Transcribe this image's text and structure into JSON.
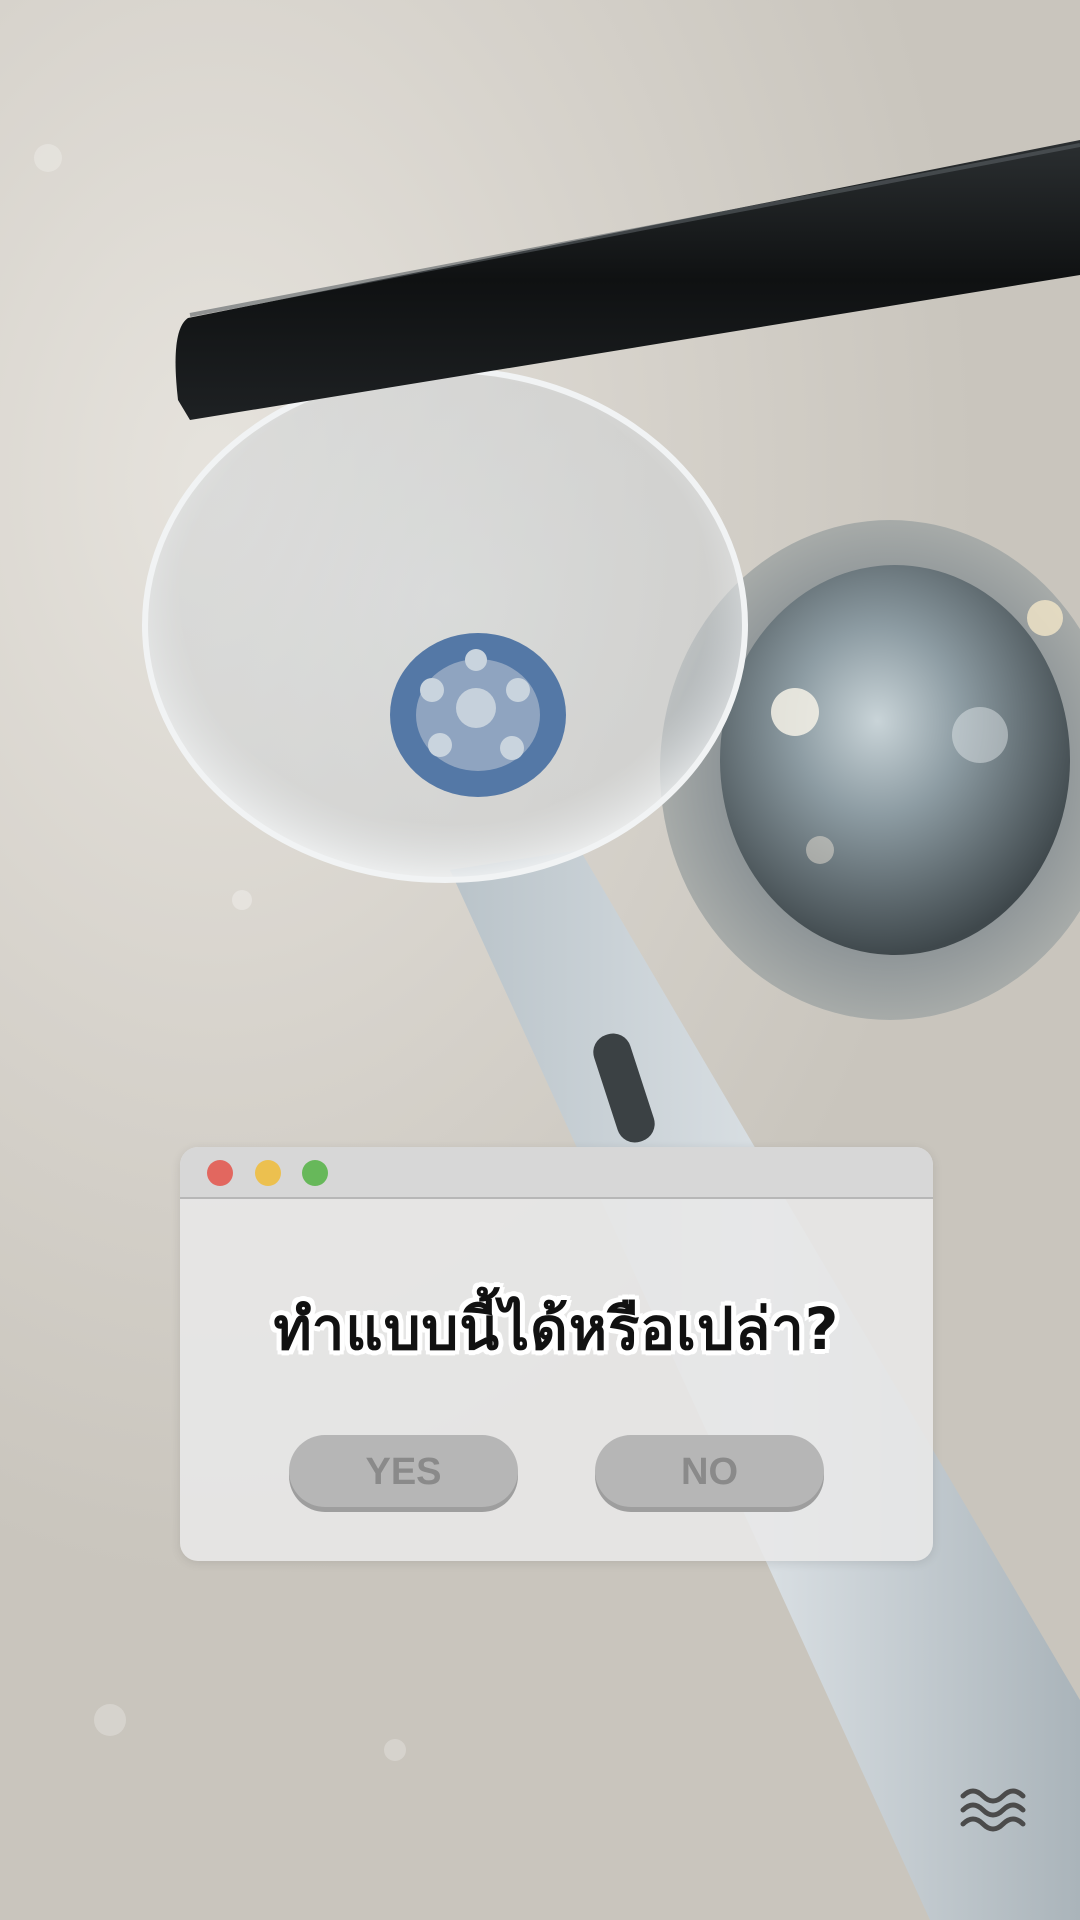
{
  "dialog": {
    "question": "ทำแบบนี้ได้หรือเปล่า?",
    "yes_label": "YES",
    "no_label": "NO",
    "window_controls": {
      "close": "#e2675f",
      "minimize": "#ecc04f",
      "zoom": "#67b85a"
    }
  },
  "icons": {
    "watermark": "wave-logo-icon"
  }
}
